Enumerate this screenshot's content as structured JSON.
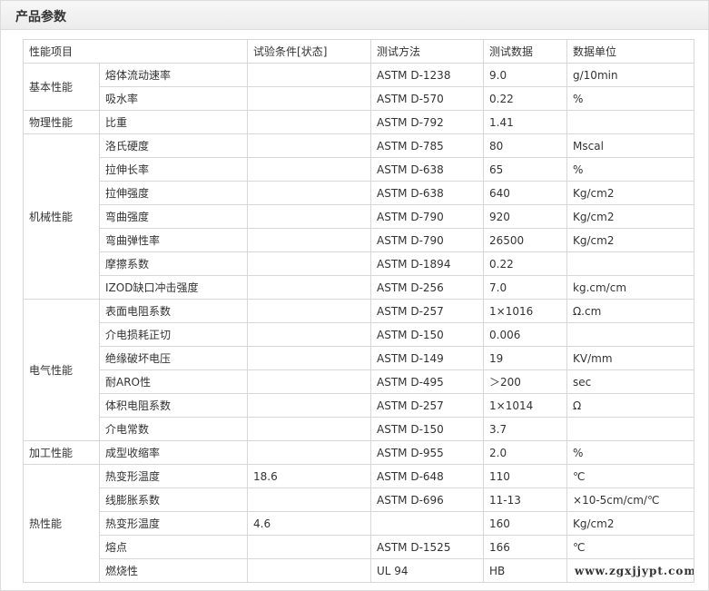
{
  "panel": {
    "title": "产品参数"
  },
  "table": {
    "headers": [
      "性能项目",
      "试验条件[状态]",
      "测试方法",
      "测试数据",
      "数据单位"
    ],
    "groups": [
      {
        "name": "基本性能",
        "rows": [
          {
            "item": "熔体流动速率",
            "condition": "",
            "method": "ASTM D-1238",
            "value": "9.0",
            "unit": "g/10min"
          },
          {
            "item": "吸水率",
            "condition": "",
            "method": "ASTM D-570",
            "value": "0.22",
            "unit": "%"
          }
        ]
      },
      {
        "name": "物理性能",
        "rows": [
          {
            "item": "比重",
            "condition": "",
            "method": "ASTM D-792",
            "value": "1.41",
            "unit": ""
          }
        ]
      },
      {
        "name": "机械性能",
        "rows": [
          {
            "item": "洛氏硬度",
            "condition": "",
            "method": "ASTM D-785",
            "value": "80",
            "unit": "Mscal"
          },
          {
            "item": "拉伸长率",
            "condition": "",
            "method": "ASTM D-638",
            "value": "65",
            "unit": "%"
          },
          {
            "item": "拉伸强度",
            "condition": "",
            "method": "ASTM D-638",
            "value": "640",
            "unit": "Kg/cm2"
          },
          {
            "item": "弯曲强度",
            "condition": "",
            "method": "ASTM D-790",
            "value": "920",
            "unit": "Kg/cm2"
          },
          {
            "item": "弯曲弹性率",
            "condition": "",
            "method": "ASTM D-790",
            "value": "26500",
            "unit": "Kg/cm2"
          },
          {
            "item": "摩擦系数",
            "condition": "",
            "method": "ASTM D-1894",
            "value": "0.22",
            "unit": ""
          },
          {
            "item": "IZOD缺口冲击强度",
            "condition": "",
            "method": "ASTM D-256",
            "value": "7.0",
            "unit": "kg.cm/cm"
          }
        ]
      },
      {
        "name": "电气性能",
        "rows": [
          {
            "item": "表面电阻系数",
            "condition": "",
            "method": "ASTM D-257",
            "value": "1×1016",
            "unit": "Ω.cm"
          },
          {
            "item": "介电损耗正切",
            "condition": "",
            "method": "ASTM D-150",
            "value": "0.006",
            "unit": ""
          },
          {
            "item": "绝缘破坏电压",
            "condition": "",
            "method": "ASTM D-149",
            "value": "19",
            "unit": "KV/mm"
          },
          {
            "item": "耐ARO性",
            "condition": "",
            "method": "ASTM D-495",
            "value": "＞200",
            "unit": "sec"
          },
          {
            "item": "体积电阻系数",
            "condition": "",
            "method": "ASTM D-257",
            "value": "1×1014",
            "unit": "Ω"
          },
          {
            "item": "介电常数",
            "condition": "",
            "method": "ASTM D-150",
            "value": "3.7",
            "unit": ""
          }
        ]
      },
      {
        "name": "加工性能",
        "rows": [
          {
            "item": "成型收缩率",
            "condition": "",
            "method": "ASTM D-955",
            "value": "2.0",
            "unit": "%"
          }
        ]
      },
      {
        "name": "热性能",
        "rows": [
          {
            "item": "热变形温度",
            "condition": "18.6",
            "method": "ASTM D-648",
            "value": "110",
            "unit": "℃"
          },
          {
            "item": "线膨胀系数",
            "condition": "",
            "method": "ASTM D-696",
            "value": "11-13",
            "unit": "×10-5cm/cm/℃"
          },
          {
            "item": "热变形温度",
            "condition": "4.6",
            "method": "",
            "value": "160",
            "unit": "Kg/cm2"
          },
          {
            "item": "熔点",
            "condition": "",
            "method": "ASTM D-1525",
            "value": "166",
            "unit": "℃"
          },
          {
            "item": "燃烧性",
            "condition": "",
            "method": "UL 94",
            "value": "HB",
            "unit": ""
          }
        ]
      }
    ]
  },
  "watermark": {
    "text": "www.zgxjjypt.com"
  }
}
